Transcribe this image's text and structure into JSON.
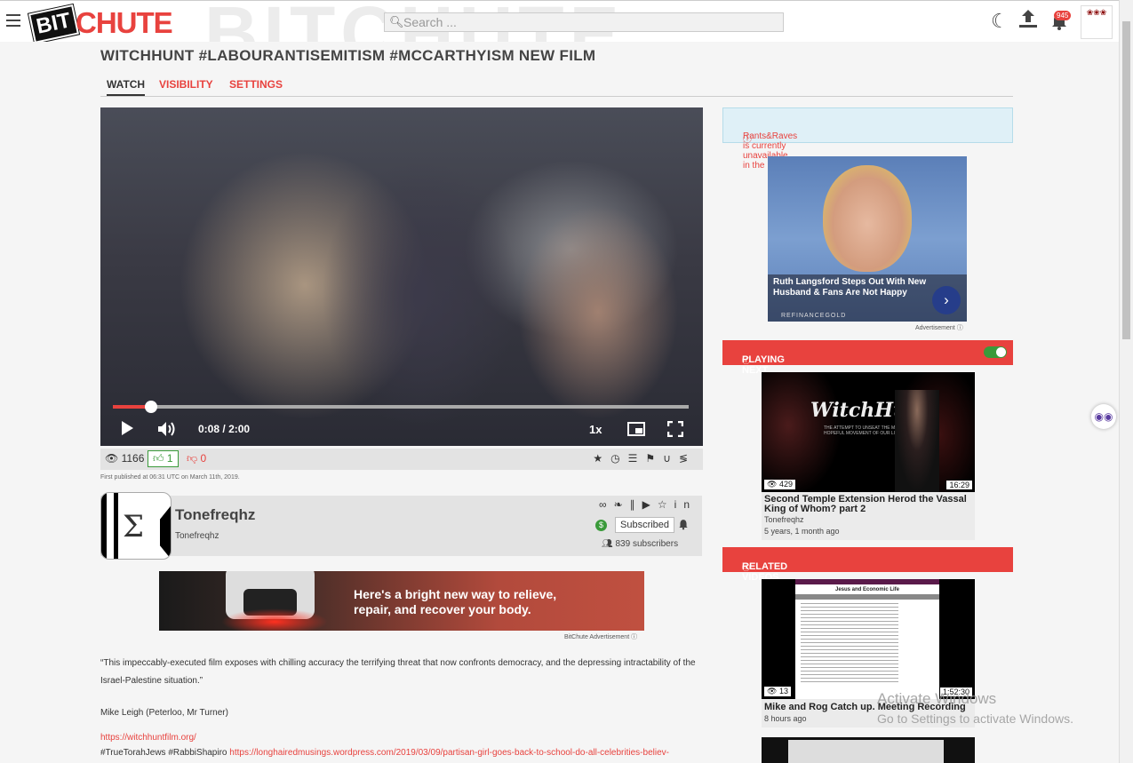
{
  "header": {
    "logo_bit": "BIT",
    "logo_chute": "CHUTE",
    "search_placeholder": "Search ...",
    "notification_count": "945"
  },
  "video": {
    "title": "WITCHHUNT #LABOURANTISEMITISM #MCCARTHYISM NEW FILM",
    "tabs": [
      "WATCH",
      "VISIBILITY",
      "SETTINGS"
    ],
    "progress_fraction": 0.067,
    "time_current": "0:08",
    "time_separator": "/",
    "time_total": "2:00",
    "speed": "1x",
    "views": "1166",
    "likes": "1",
    "dislikes": "0",
    "published": "First published at 06:31 UTC on March 11th, 2019."
  },
  "channel": {
    "name": "Tonefreqhz",
    "owner": "Tonefreqhz",
    "subscribe_label": "Subscribed",
    "subscribers": "839 subscribers"
  },
  "ad_banner": {
    "line1": "Here's a bright new way to relieve,",
    "line2": "repair, and recover your body.",
    "caption": "BitChute Advertisement"
  },
  "description": {
    "quote": "“This impeccably-executed film exposes with chilling accuracy the terrifying threat that now confronts democracy, and the depressing intractability of the Israel-Palestine situation.”",
    "attribution": "Mike Leigh (Peterloo, Mr Turner)",
    "link1": "https://witchhuntfilm.org/",
    "tags": "#TrueTorahJews #RabbiShapiro",
    "link2": "https://longhairedmusings.wordpress.com/2019/03/09/partisan-girl-goes-back-to-school-do-all-celebrities-believ-"
  },
  "sidebar": {
    "alert": "Rants&Raves is currently unavailable in the UK",
    "ad_headline": "Ruth Langsford Steps Out With New Husband & Fans Are Not Happy",
    "ad_brand": "REFINANCEGOLD",
    "ad_label": "Advertisement",
    "playing_next_label": "PLAYING NEXT",
    "related_label": "RELATED VIDEOS",
    "playing_next": {
      "thumb_title": "WitchHunt",
      "thumb_subtitle": "THE ATTEMPT TO UNSEAT THE MOST HOPEFUL MOVEMENT OF OUR LIFETIME",
      "views": "429",
      "duration": "16:29",
      "title": "Second Temple Extension Herod the Vassal King of Whom? part 2",
      "channel": "Tonefreqhz",
      "age": "5 years, 1 month ago"
    },
    "related": [
      {
        "thumb_title": "Jesus and Economic Life",
        "views": "13",
        "duration": "1:52:30",
        "title": "Mike and Rog Catch up. Meeting Recording",
        "age": "8 hours ago"
      }
    ]
  },
  "os_watermark": {
    "line1": "Activate Windows",
    "line2": "Go to Settings to activate Windows."
  }
}
